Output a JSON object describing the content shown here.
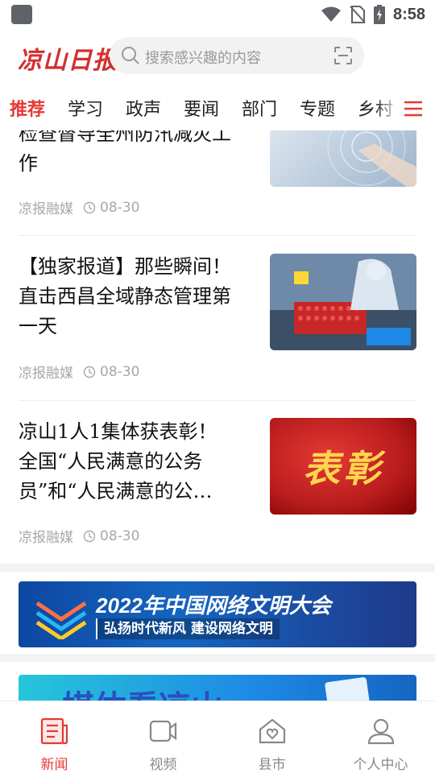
{
  "status_bar": {
    "time": "8:58"
  },
  "header": {
    "logo_text": "凉山日报",
    "search_placeholder": "搜索感兴趣的内容"
  },
  "tabs": [
    {
      "label": "推荐",
      "active": true
    },
    {
      "label": "学习",
      "active": false
    },
    {
      "label": "政声",
      "active": false
    },
    {
      "label": "要闻",
      "active": false
    },
    {
      "label": "部门",
      "active": false
    },
    {
      "label": "专题",
      "active": false
    },
    {
      "label": "乡村",
      "active": false
    }
  ],
  "articles": [
    {
      "title_line1": "检查督导全州防汛减灾工",
      "title_line2": "作",
      "source": "凉报融媒",
      "date": "08-30"
    },
    {
      "title_line1": "【独家报道】那些瞬间！",
      "title_line2": "直击西昌全域静态管理第",
      "title_line3": "一天",
      "source": "凉报融媒",
      "date": "08-30"
    },
    {
      "title_line1": "凉山1人1集体获表彰！",
      "title_line2": "全国“人民满意的公务",
      "title_line3": "员”和“人民满意的公…",
      "source": "凉报融媒",
      "date": "08-30",
      "thumb_text": "表彰"
    }
  ],
  "banners": {
    "civilization": {
      "title": "2022年中国网络文明大会",
      "subtitle": "弘扬时代新风 建设网络文明"
    },
    "media": {
      "title": "媒体看凉山"
    }
  },
  "bottom_nav": [
    {
      "label": "新闻",
      "active": true
    },
    {
      "label": "视频",
      "active": false
    },
    {
      "label": "县市",
      "active": false
    },
    {
      "label": "个人中心",
      "active": false
    }
  ],
  "colors": {
    "accent": "#e53935",
    "muted": "#a8a8a8"
  }
}
